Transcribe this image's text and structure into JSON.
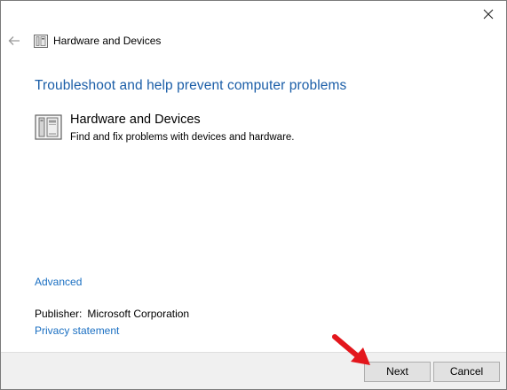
{
  "window": {
    "title": "Hardware and Devices",
    "close_icon": "close-icon",
    "back_icon": "back-arrow-icon"
  },
  "main": {
    "heading": "Troubleshoot and help prevent computer problems",
    "troubleshooter": {
      "name": "Hardware and Devices",
      "description": "Find and fix problems with devices and hardware.",
      "icon": "hardware-devices-icon"
    },
    "advanced_link": "Advanced",
    "publisher_label": "Publisher:",
    "publisher_value": "Microsoft Corporation",
    "privacy_link": "Privacy statement"
  },
  "footer": {
    "next_label": "Next",
    "cancel_label": "Cancel"
  },
  "colors": {
    "heading": "#1b5ea8",
    "link": "#1a6fc2",
    "annotation_arrow": "#e3161c"
  }
}
